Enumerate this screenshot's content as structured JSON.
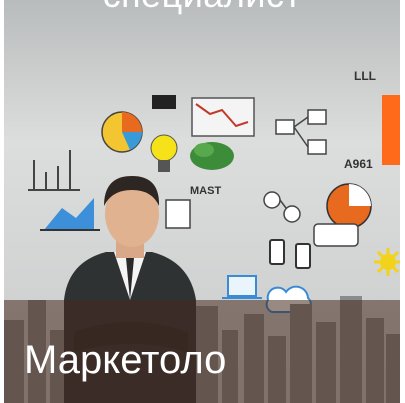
{
  "banner": {
    "top_text": "специалист",
    "bottom_text": "Маркетоло"
  },
  "photo": {
    "icon_names": [
      "bar-chart-icon",
      "pie-chart-icon",
      "lightbulb-icon",
      "money-icon",
      "line-chart-icon",
      "flowchart-icon",
      "speech-bubble-icon",
      "laptop-icon",
      "cloud-icon",
      "gear-icon",
      "mobile-phone-icon",
      "city-skyline-icon",
      "businessman-figure"
    ],
    "handwriting": [
      "MAST",
      "A961",
      "LLL"
    ]
  }
}
